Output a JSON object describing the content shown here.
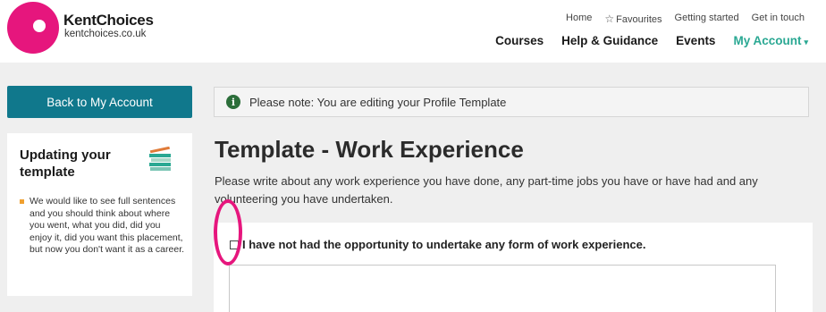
{
  "brand": {
    "name": "KentChoices",
    "url": "kentchoices.co.uk",
    "color": "#e6167d"
  },
  "util_nav": {
    "home": "Home",
    "favourites": "Favourites",
    "getting_started": "Getting started",
    "get_in_touch": "Get in touch"
  },
  "main_nav": {
    "courses": "Courses",
    "help": "Help & Guidance",
    "events": "Events",
    "account": "My Account"
  },
  "sidebar": {
    "back_label": "Back to My Account",
    "card_title": "Updating your template",
    "bullet": "We would like to see full sentences and you should think about where you went, what you did, did you enjoy it, did you want this placement, but now you don't want it as a career."
  },
  "notice": "Please note: You are editing your Profile Template",
  "main": {
    "title": "Template - Work Experience",
    "description": "Please write about any work experience you have done, any part-time jobs you have or have had and any volunteering you have undertaken.",
    "checkbox_label": "I have not had the opportunity to undertake any form of work experience.",
    "checkbox_checked": false
  },
  "colors": {
    "accent_teal": "#10788c",
    "account_green": "#2aa893",
    "info_green": "#2c6e3a"
  }
}
